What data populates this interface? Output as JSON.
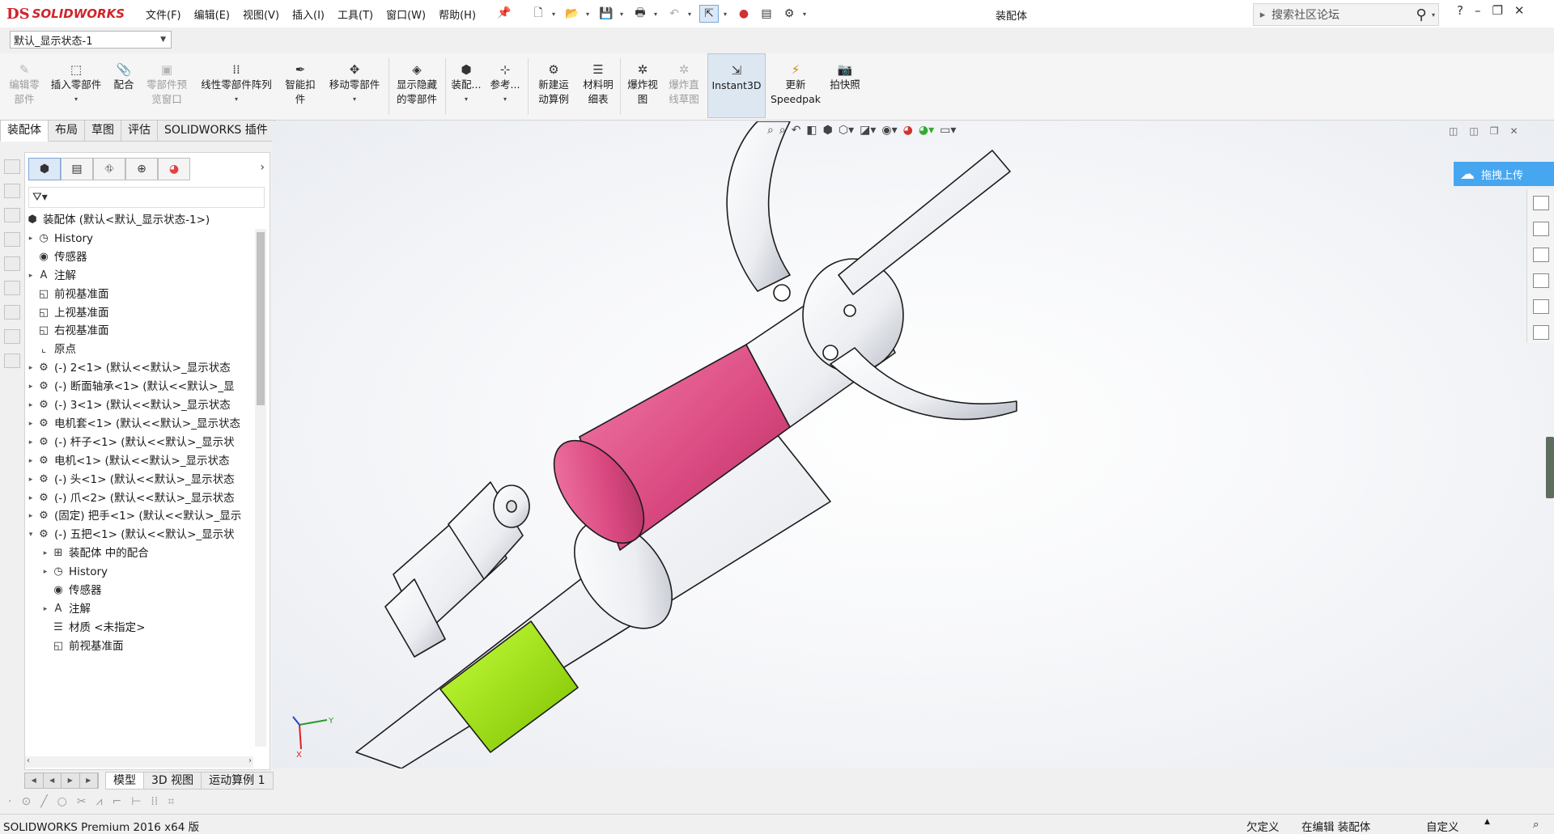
{
  "app": {
    "logo_ds": "DS",
    "logo_name": "SOLIDWORKS",
    "document_title": "装配体",
    "menu": [
      "文件(F)",
      "编辑(E)",
      "视图(V)",
      "插入(I)",
      "工具(T)",
      "窗口(W)",
      "帮助(H)"
    ],
    "search_placeholder": "搜索社区论坛",
    "help_label": "?"
  },
  "config": {
    "selected": "默认_显示状态-1"
  },
  "commands": [
    {
      "label": "编辑零\n部件",
      "icon": "edit-component-icon",
      "disabled": true
    },
    {
      "label": "插入零部件",
      "icon": "insert-component-icon",
      "disabled": false
    },
    {
      "label": "配合",
      "icon": "mate-icon",
      "disabled": false
    },
    {
      "label": "零部件预\n览窗口",
      "icon": "component-preview-icon",
      "disabled": true
    },
    {
      "label": "线性零部件阵列",
      "icon": "linear-pattern-icon",
      "disabled": false
    },
    {
      "label": "智能扣\n件",
      "icon": "smart-fasteners-icon",
      "disabled": false
    },
    {
      "label": "移动零部件",
      "icon": "move-component-icon",
      "disabled": false
    },
    {
      "label": "显示隐藏\n的零部件",
      "icon": "show-hidden-icon",
      "disabled": false
    },
    {
      "label": "装配...",
      "icon": "assembly-features-icon",
      "disabled": false
    },
    {
      "label": "参考...",
      "icon": "reference-geometry-icon",
      "disabled": false
    },
    {
      "label": "新建运\n动算例",
      "icon": "new-motion-study-icon",
      "disabled": false
    },
    {
      "label": "材料明\n细表",
      "icon": "bom-icon",
      "disabled": false
    },
    {
      "label": "爆炸视\n图",
      "icon": "exploded-view-icon",
      "disabled": false
    },
    {
      "label": "爆炸直\n线草图",
      "icon": "explode-line-sketch-icon",
      "disabled": true
    },
    {
      "label": "Instant3D",
      "icon": "instant3d-icon",
      "disabled": false
    },
    {
      "label": "更新\nSpeedpak",
      "icon": "speedpak-icon",
      "disabled": false
    },
    {
      "label": "拍快照",
      "icon": "snapshot-icon",
      "disabled": false
    }
  ],
  "tabs": [
    "装配体",
    "布局",
    "草图",
    "评估",
    "SOLIDWORKS 插件"
  ],
  "tree": [
    {
      "label": "装配体 (默认<默认_显示状态-1>)",
      "icon": "assembly-icon",
      "level": 0,
      "twisty": ""
    },
    {
      "label": "History",
      "icon": "history-icon",
      "level": 1,
      "twisty": "▸"
    },
    {
      "label": "传感器",
      "icon": "sensor-icon",
      "level": 1,
      "twisty": ""
    },
    {
      "label": "注解",
      "icon": "annotation-icon",
      "level": 1,
      "twisty": "▸"
    },
    {
      "label": "前视基准面",
      "icon": "plane-icon",
      "level": 1,
      "twisty": ""
    },
    {
      "label": "上视基准面",
      "icon": "plane-icon",
      "level": 1,
      "twisty": ""
    },
    {
      "label": "右视基准面",
      "icon": "plane-icon",
      "level": 1,
      "twisty": ""
    },
    {
      "label": "原点",
      "icon": "origin-icon",
      "level": 1,
      "twisty": ""
    },
    {
      "label": "(-) 2<1> (默认<<默认>_显示状态",
      "icon": "part-icon",
      "level": 1,
      "twisty": "▸"
    },
    {
      "label": "(-) 断面轴承<1> (默认<<默认>_显",
      "icon": "part-icon",
      "level": 1,
      "twisty": "▸"
    },
    {
      "label": "(-) 3<1> (默认<<默认>_显示状态",
      "icon": "part-icon",
      "level": 1,
      "twisty": "▸"
    },
    {
      "label": "电机套<1> (默认<<默认>_显示状态",
      "icon": "part-icon",
      "level": 1,
      "twisty": "▸"
    },
    {
      "label": "(-) 杆子<1> (默认<<默认>_显示状",
      "icon": "part-icon",
      "level": 1,
      "twisty": "▸"
    },
    {
      "label": "电机<1> (默认<<默认>_显示状态",
      "icon": "part-icon",
      "level": 1,
      "twisty": "▸"
    },
    {
      "label": "(-) 头<1> (默认<<默认>_显示状态",
      "icon": "part-icon",
      "level": 1,
      "twisty": "▸"
    },
    {
      "label": "(-) 爪<2> (默认<<默认>_显示状态",
      "icon": "part-icon",
      "level": 1,
      "twisty": "▸"
    },
    {
      "label": "(固定) 把手<1> (默认<<默认>_显示",
      "icon": "part-icon",
      "level": 1,
      "twisty": "▸"
    },
    {
      "label": "(-) 五把<1> (默认<<默认>_显示状",
      "icon": "part-icon",
      "level": 1,
      "twisty": "▾"
    },
    {
      "label": "装配体 中的配合",
      "icon": "mates-folder-icon",
      "level": 2,
      "twisty": "▸"
    },
    {
      "label": "History",
      "icon": "history-icon",
      "level": 2,
      "twisty": "▸"
    },
    {
      "label": "传感器",
      "icon": "sensor-icon",
      "level": 2,
      "twisty": ""
    },
    {
      "label": "注解",
      "icon": "annotation-icon",
      "level": 2,
      "twisty": "▸"
    },
    {
      "label": "材质 <未指定>",
      "icon": "material-icon",
      "level": 2,
      "twisty": ""
    },
    {
      "label": "前视基准面",
      "icon": "plane-icon",
      "level": 2,
      "twisty": ""
    }
  ],
  "bottom_tabs": [
    "模型",
    "3D 视图",
    "运动算例 1"
  ],
  "viewport": {
    "upload_label": "拖拽上传",
    "triad_y": "Y",
    "triad_x": "X"
  },
  "status": {
    "left": "SOLIDWORKS Premium 2016 x64 版",
    "undefined": "欠定义",
    "editing": "在编辑 装配体",
    "custom": "自定义",
    "custom_caret": "▲"
  },
  "colors": {
    "brand_red": "#d2232a",
    "accent_blue": "#47a6f0",
    "pink_part": "#e0588e",
    "green_part": "#9ee000"
  }
}
